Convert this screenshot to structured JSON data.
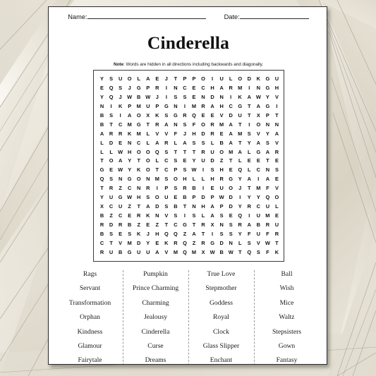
{
  "background": {
    "style": "folded-beige-paper-texture",
    "base_color": "#e6e1d4"
  },
  "page": {
    "bg_color": "#ffffff",
    "border_color": "#2b2b2b"
  },
  "header": {
    "name_label": "Name:",
    "date_label": "Date:"
  },
  "title": "Cinderella",
  "note": {
    "prefix": "Note",
    "separator": ": ",
    "text": "Words are hidden in all directions including backwards and diagonally."
  },
  "puzzle": {
    "rows": 20,
    "cols": 20,
    "grid": [
      [
        "Y",
        "S",
        "U",
        "O",
        "L",
        "A",
        "E",
        "J",
        "T",
        "P",
        "P",
        "O",
        "I",
        "U",
        "L",
        "O",
        "D",
        "K",
        "G",
        "U"
      ],
      [
        "E",
        "Q",
        "S",
        "J",
        "G",
        "P",
        "R",
        "I",
        "N",
        "C",
        "E",
        "C",
        "H",
        "A",
        "R",
        "M",
        "I",
        "N",
        "G",
        "H"
      ],
      [
        "Y",
        "Q",
        "J",
        "W",
        "B",
        "W",
        "J",
        "I",
        "S",
        "S",
        "E",
        "N",
        "D",
        "N",
        "I",
        "K",
        "A",
        "W",
        "Y",
        "V"
      ],
      [
        "N",
        "I",
        "K",
        "P",
        "M",
        "U",
        "P",
        "G",
        "N",
        "I",
        "M",
        "R",
        "A",
        "H",
        "C",
        "G",
        "T",
        "A",
        "G",
        "I"
      ],
      [
        "B",
        "S",
        "I",
        "A",
        "O",
        "X",
        "K",
        "S",
        "G",
        "R",
        "Q",
        "E",
        "E",
        "V",
        "D",
        "U",
        "T",
        "X",
        "P",
        "T"
      ],
      [
        "B",
        "T",
        "C",
        "M",
        "G",
        "T",
        "R",
        "A",
        "N",
        "S",
        "F",
        "O",
        "R",
        "M",
        "A",
        "T",
        "I",
        "O",
        "N",
        "N"
      ],
      [
        "A",
        "R",
        "R",
        "K",
        "M",
        "L",
        "V",
        "V",
        "F",
        "J",
        "H",
        "D",
        "R",
        "E",
        "A",
        "M",
        "S",
        "V",
        "Y",
        "A"
      ],
      [
        "L",
        "D",
        "E",
        "N",
        "C",
        "L",
        "A",
        "R",
        "L",
        "A",
        "S",
        "S",
        "L",
        "B",
        "A",
        "T",
        "Y",
        "A",
        "S",
        "V"
      ],
      [
        "L",
        "L",
        "W",
        "H",
        "O",
        "O",
        "Q",
        "S",
        "T",
        "T",
        "T",
        "R",
        "U",
        "O",
        "M",
        "A",
        "L",
        "G",
        "A",
        "R"
      ],
      [
        "T",
        "O",
        "A",
        "Y",
        "T",
        "O",
        "L",
        "C",
        "S",
        "E",
        "Y",
        "U",
        "D",
        "Z",
        "T",
        "L",
        "E",
        "E",
        "T",
        "E"
      ],
      [
        "G",
        "E",
        "W",
        "Y",
        "K",
        "O",
        "T",
        "C",
        "P",
        "S",
        "W",
        "I",
        "S",
        "H",
        "E",
        "Q",
        "L",
        "C",
        "N",
        "S"
      ],
      [
        "Q",
        "S",
        "N",
        "G",
        "O",
        "N",
        "M",
        "S",
        "O",
        "H",
        "L",
        "L",
        "H",
        "R",
        "G",
        "Y",
        "A",
        "I",
        "A",
        "E"
      ],
      [
        "T",
        "R",
        "Z",
        "C",
        "N",
        "R",
        "I",
        "P",
        "S",
        "R",
        "B",
        "I",
        "E",
        "U",
        "O",
        "J",
        "T",
        "M",
        "F",
        "V"
      ],
      [
        "Y",
        "U",
        "G",
        "W",
        "H",
        "S",
        "O",
        "U",
        "E",
        "B",
        "P",
        "D",
        "P",
        "W",
        "D",
        "I",
        "Y",
        "Y",
        "Q",
        "O"
      ],
      [
        "X",
        "C",
        "U",
        "Z",
        "T",
        "A",
        "D",
        "S",
        "B",
        "T",
        "N",
        "H",
        "A",
        "P",
        "D",
        "Y",
        "R",
        "C",
        "U",
        "L"
      ],
      [
        "B",
        "Z",
        "C",
        "E",
        "R",
        "K",
        "N",
        "V",
        "S",
        "I",
        "S",
        "L",
        "A",
        "S",
        "E",
        "Q",
        "I",
        "U",
        "M",
        "E"
      ],
      [
        "R",
        "D",
        "R",
        "B",
        "Z",
        "E",
        "Z",
        "T",
        "C",
        "G",
        "T",
        "R",
        "X",
        "N",
        "S",
        "R",
        "A",
        "B",
        "R",
        "U"
      ],
      [
        "B",
        "S",
        "E",
        "S",
        "K",
        "J",
        "H",
        "Q",
        "Q",
        "Z",
        "A",
        "T",
        "I",
        "S",
        "S",
        "Y",
        "F",
        "U",
        "F",
        "R"
      ],
      [
        "C",
        "T",
        "V",
        "M",
        "D",
        "Y",
        "E",
        "K",
        "R",
        "Q",
        "Z",
        "R",
        "G",
        "D",
        "N",
        "L",
        "S",
        "V",
        "W",
        "T"
      ],
      [
        "R",
        "U",
        "B",
        "G",
        "U",
        "U",
        "A",
        "V",
        "M",
        "Q",
        "M",
        "X",
        "W",
        "B",
        "W",
        "T",
        "Q",
        "S",
        "F",
        "K"
      ]
    ]
  },
  "wordlist": {
    "columns": [
      [
        "Rags",
        "Servant",
        "Transformation",
        "Orphan",
        "Kindness",
        "Glamour",
        "Fairytale"
      ],
      [
        "Pumpkin",
        "Prince Charming",
        "Charming",
        "Jealousy",
        "Cinderella",
        "Curse",
        "Dreams"
      ],
      [
        "True Love",
        "Stepmother",
        "Goddess",
        "Royal",
        "Clock",
        "Glass Slipper",
        "Enchant"
      ],
      [
        "Ball",
        "Wish",
        "Mice",
        "Waltz",
        "Stepsisters",
        "Gown",
        "Fantasy"
      ]
    ]
  }
}
